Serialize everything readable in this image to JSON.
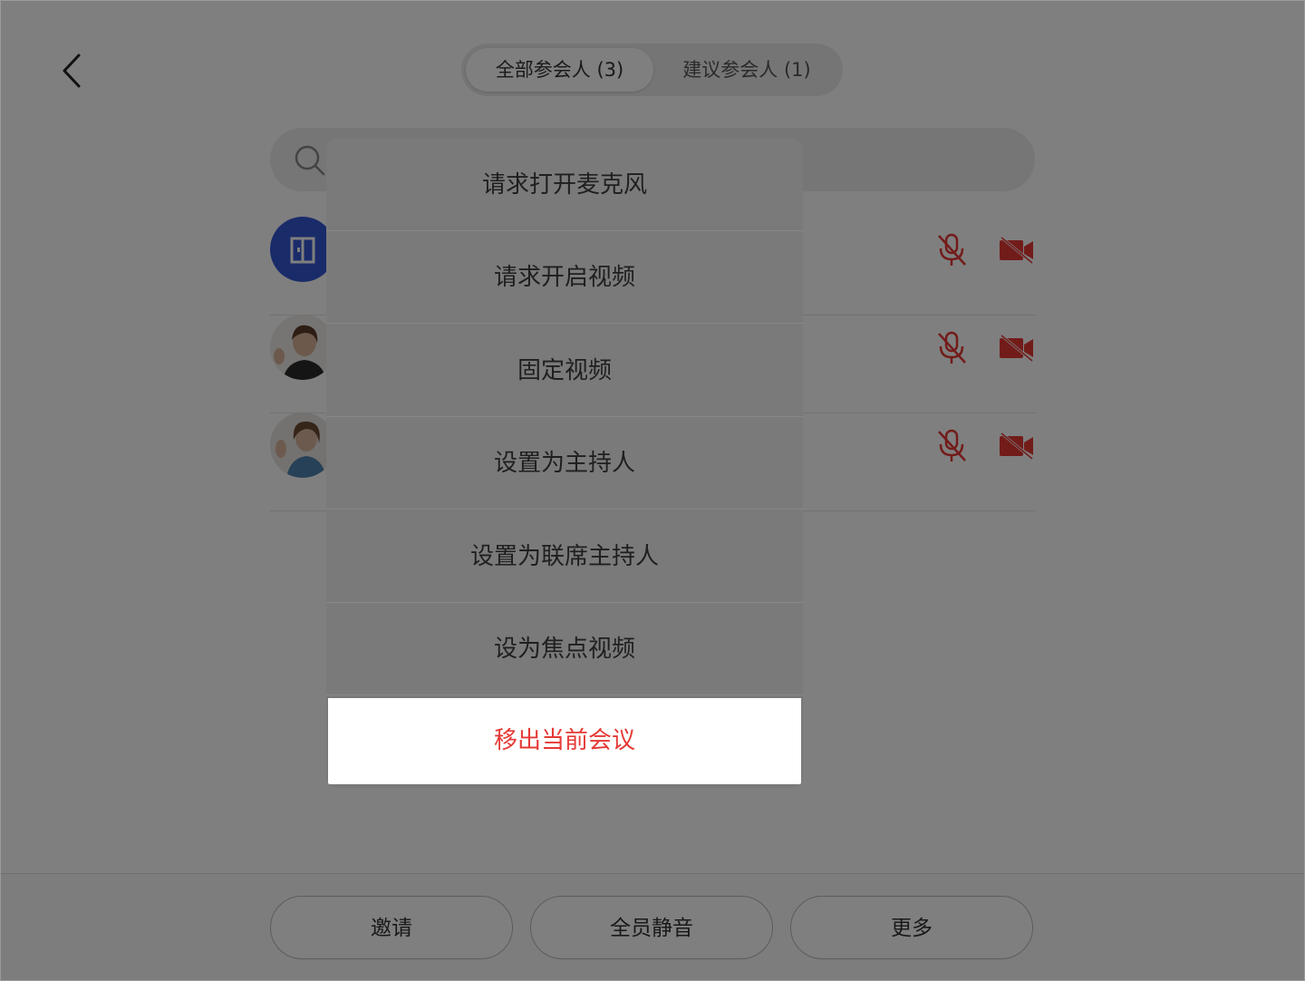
{
  "header": {
    "tabs": [
      {
        "label": "全部参会人 (3)",
        "active": true
      },
      {
        "label": "建议参会人 (1)",
        "active": false
      }
    ]
  },
  "participants": [
    {
      "avatar": "room-icon",
      "mic": "muted",
      "camera": "off"
    },
    {
      "avatar": "photo-woman-waving",
      "mic": "muted",
      "camera": "off"
    },
    {
      "avatar": "photo-woman-waving",
      "mic": "muted",
      "camera": "off"
    }
  ],
  "bottom_bar": {
    "invite": "邀请",
    "mute_all": "全员静音",
    "more": "更多"
  },
  "action_sheet": {
    "items": [
      {
        "label": "请求打开麦克风"
      },
      {
        "label": "请求开启视频"
      },
      {
        "label": "固定视频"
      },
      {
        "label": "设置为主持人"
      },
      {
        "label": "设置为联席主持人"
      },
      {
        "label": "设为焦点视频"
      },
      {
        "label": "移出当前会议"
      }
    ]
  },
  "colors": {
    "danger": "#e53935",
    "avatar_blue": "#3457d5",
    "muted_icon": "#e53935"
  }
}
